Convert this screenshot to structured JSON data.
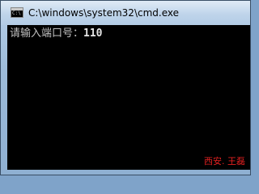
{
  "window": {
    "title": "C:\\windows\\system32\\cmd.exe",
    "icon": "cmd-console-icon",
    "icon_text": "C:\\"
  },
  "console": {
    "prompt": "请输入端口号：",
    "input_value": "110"
  },
  "watermark": "西安. 王磊",
  "colors": {
    "console_background": "#000000",
    "console_text": "#c0c0c0",
    "watermark": "#e02020"
  }
}
